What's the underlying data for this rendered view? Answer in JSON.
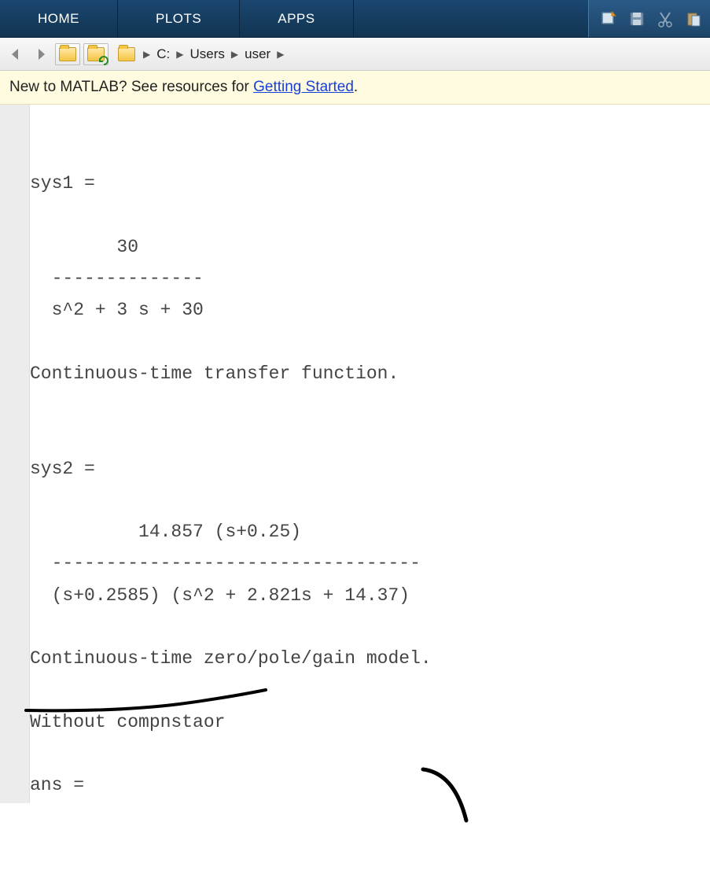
{
  "tabs": [
    "HOME",
    "PLOTS",
    "APPS"
  ],
  "breadcrumb": [
    "C:",
    "Users",
    "user"
  ],
  "banner": {
    "prefix": "New to MATLAB? See resources for ",
    "link": "Getting Started",
    "suffix": "."
  },
  "output": {
    "sys1_label": "sys1 =",
    "sys1_num": "        30",
    "sys1_div": "  --------------",
    "sys1_den": "  s^2 + 3 s + 30",
    "sys1_desc": "Continuous-time transfer function.",
    "sys2_label": "sys2 =",
    "sys2_num": "          14.857 (s+0.25)",
    "sys2_div": "  ----------------------------------",
    "sys2_den": "  (s+0.2585) (s^2 + 2.821s + 14.37)",
    "sys2_desc": "Continuous-time zero/pole/gain model.",
    "without_comp": "Without compnstaor",
    "ans_label": "ans ="
  }
}
